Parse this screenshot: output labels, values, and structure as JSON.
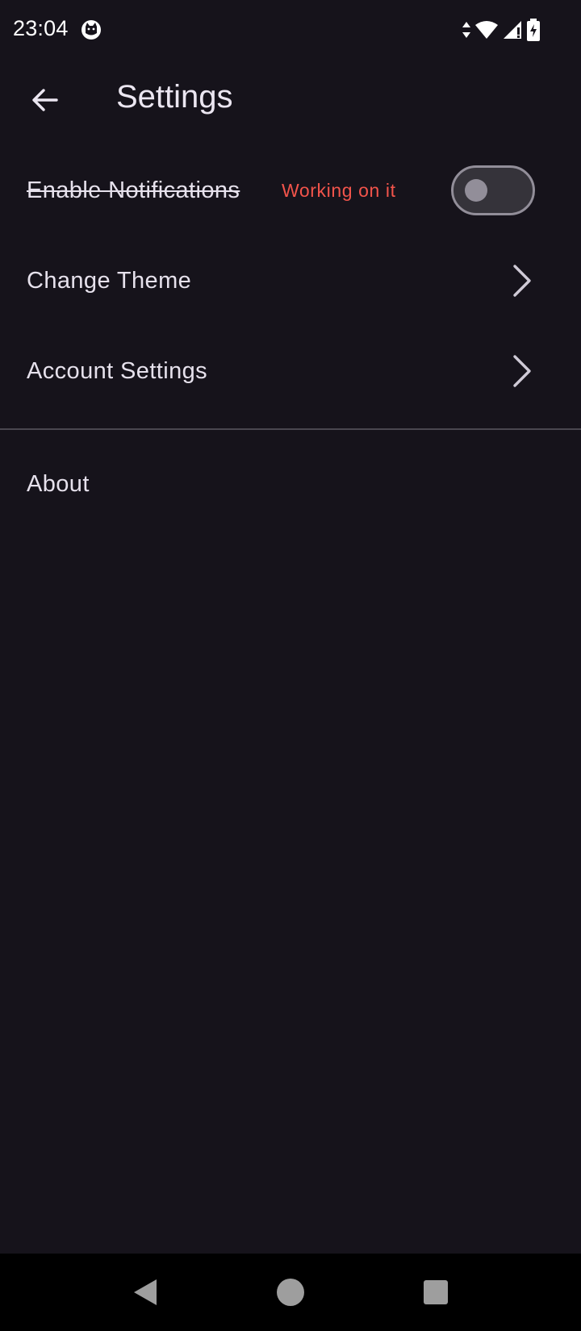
{
  "status_bar": {
    "time": "23:04",
    "icons": [
      "cat-face-icon",
      "data-arrows-icon",
      "wifi-icon",
      "signal-icon",
      "battery-charging-icon"
    ]
  },
  "app_bar": {
    "title": "Settings",
    "back_icon": "arrow-left-icon"
  },
  "settings": {
    "items": [
      {
        "label": "Enable Notifications",
        "strikethrough": true,
        "badge": "Working on it",
        "badge_color": "#f2544b",
        "control": "toggle",
        "toggle_on": false
      },
      {
        "label": "Change Theme",
        "control": "chevron-right-icon"
      },
      {
        "label": "Account Settings",
        "control": "chevron-right-icon"
      }
    ],
    "about_label": "About"
  },
  "nav_bar": {
    "buttons": [
      "back-triangle-icon",
      "home-circle-icon",
      "recents-square-icon"
    ]
  },
  "colors": {
    "background": "#16131b",
    "text": "#e6e1ec",
    "accent_warning": "#f2544b",
    "toggle_outline": "#928e99"
  }
}
